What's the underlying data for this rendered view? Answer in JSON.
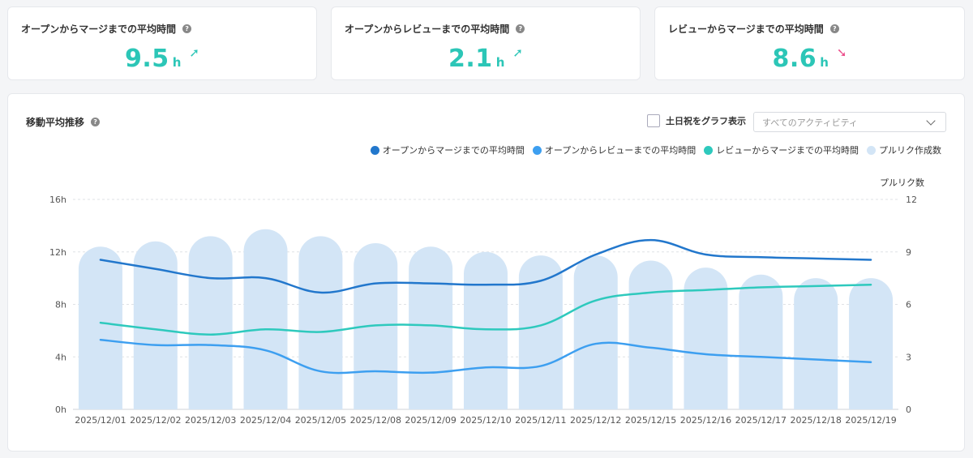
{
  "kpis": [
    {
      "title": "オープンからマージまでの平均時間",
      "value": "9.5",
      "unit": "h",
      "trend": "up",
      "arrow": "➚"
    },
    {
      "title": "オープンからレビューまでの平均時間",
      "value": "2.1",
      "unit": "h",
      "trend": "up",
      "arrow": "➚"
    },
    {
      "title": "レビューからマージまでの平均時間",
      "value": "8.6",
      "unit": "h",
      "trend": "down",
      "arrow": "➘"
    }
  ],
  "help_glyph": "?",
  "panel": {
    "title": "移動平均推移",
    "holiday_label": "土日祝をグラフ表示",
    "holiday_checked": false,
    "activity_select": "すべてのアクティビティ"
  },
  "colors": {
    "accent": "#2cc6b7",
    "down": "#ec4d8a",
    "open_to_merge": "#2277cc",
    "open_to_review": "#3d9ff0",
    "review_to_merge": "#2ec9bd",
    "pr_count": "#d3e5f6"
  },
  "chart_data": {
    "type": "bar",
    "categories": [
      "2025/12/01",
      "2025/12/02",
      "2025/12/03",
      "2025/12/04",
      "2025/12/05",
      "2025/12/08",
      "2025/12/09",
      "2025/12/10",
      "2025/12/11",
      "2025/12/12",
      "2025/12/15",
      "2025/12/16",
      "2025/12/17",
      "2025/12/18",
      "2025/12/19"
    ],
    "y_left": {
      "ticks": [
        "0h",
        "4h",
        "8h",
        "12h",
        "16h"
      ],
      "ylim": [
        0,
        16
      ]
    },
    "y_right": {
      "label": "プルリク数",
      "ticks": [
        "0",
        "3",
        "6",
        "9",
        "12"
      ],
      "ylim": [
        0,
        12
      ]
    },
    "legend_position": "top-right",
    "grid": true,
    "series": [
      {
        "name": "オープンからマージまでの平均時間",
        "type": "line",
        "axis": "left",
        "color_key": "open_to_merge",
        "values": [
          11.4,
          10.7,
          10.0,
          10.0,
          8.9,
          9.6,
          9.6,
          9.5,
          9.8,
          11.8,
          12.9,
          11.8,
          11.6,
          11.5,
          11.4
        ]
      },
      {
        "name": "オープンからレビューまでの平均時間",
        "type": "line",
        "axis": "left",
        "color_key": "open_to_review",
        "values": [
          5.3,
          4.9,
          4.9,
          4.5,
          2.9,
          2.9,
          2.8,
          3.2,
          3.3,
          5.0,
          4.7,
          4.2,
          4.0,
          3.8,
          3.6
        ]
      },
      {
        "name": "レビューからマージまでの平均時間",
        "type": "line",
        "axis": "left",
        "color_key": "review_to_merge",
        "values": [
          6.6,
          6.1,
          5.7,
          6.1,
          5.9,
          6.4,
          6.4,
          6.1,
          6.4,
          8.3,
          8.9,
          9.1,
          9.3,
          9.4,
          9.5
        ]
      },
      {
        "name": "プルリク作成数",
        "type": "bar",
        "axis": "right",
        "color_key": "pr_count",
        "values": [
          9.3,
          9.6,
          9.9,
          10.3,
          9.9,
          9.5,
          9.3,
          9.0,
          8.8,
          8.8,
          8.5,
          8.1,
          7.7,
          7.5,
          7.5
        ]
      }
    ]
  }
}
